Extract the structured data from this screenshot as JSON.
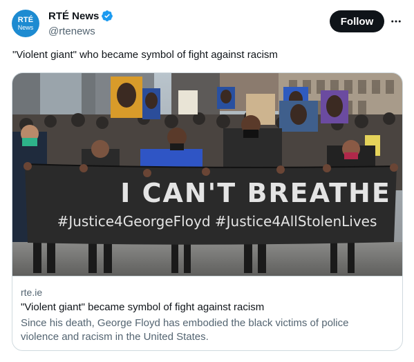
{
  "account": {
    "avatar_line1": "RTÉ",
    "avatar_line2": "News",
    "display_name": "RTÉ News",
    "handle": "@rtenews",
    "verified": true
  },
  "actions": {
    "follow_label": "Follow",
    "more_icon": "more-horizontal-icon"
  },
  "tweet": {
    "text": "\"Violent giant\" who became symbol of fight against racism"
  },
  "link_card": {
    "domain": "rte.ie",
    "title": "\"Violent giant\" became symbol of fight against racism",
    "description": "Since his death, George Floyd has embodied the black victims of police violence and racism in the United States.",
    "image": {
      "banner_line1": "I CAN'T BREATHE",
      "banner_line2": "#Justice4GeorgeFloyd #Justice4AllStolenLives"
    }
  },
  "colors": {
    "brand_blue": "#1d8bd1",
    "verified_blue": "#1d9bf0",
    "follow_bg": "#0f1419",
    "text_primary": "#0f1419",
    "text_secondary": "#536471",
    "border": "#cfd9de"
  }
}
